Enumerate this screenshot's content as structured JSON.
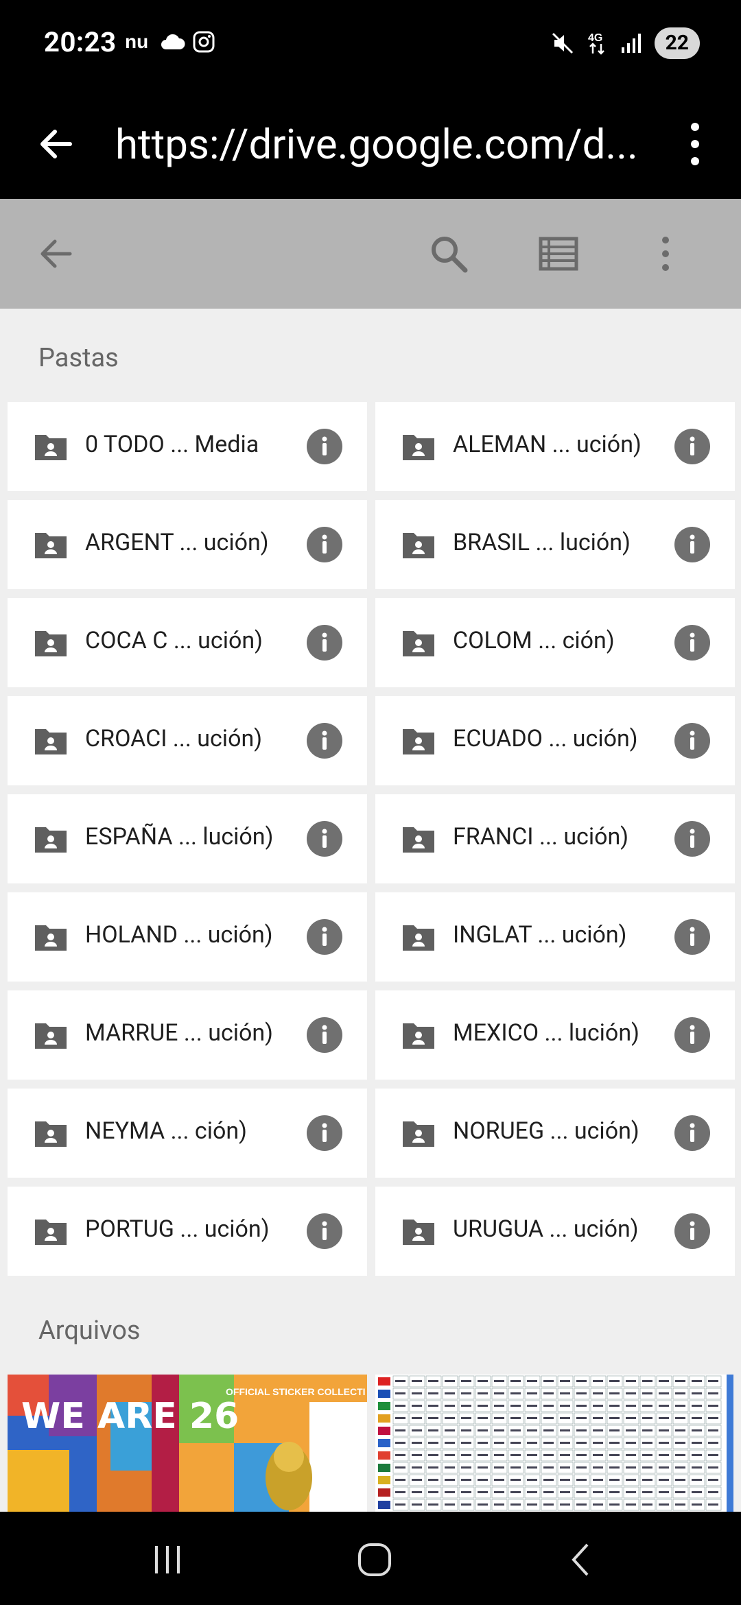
{
  "status_bar": {
    "time": "20:23",
    "left_icons": [
      "nu-app-icon",
      "cloud-icon",
      "instagram-icon"
    ],
    "right_icons": [
      "mute-icon",
      "4g-icon",
      "signal-icon"
    ],
    "battery": "22"
  },
  "browser": {
    "url": "https://drive.google.com/d..."
  },
  "section_folders": "Pastas",
  "section_files": "Arquivos",
  "folders": [
    {
      "name": "0 TODO ... Media"
    },
    {
      "name": "ALEMAN ... ución)"
    },
    {
      "name": "ARGENT ... ución)"
    },
    {
      "name": "BRASIL ... lución)"
    },
    {
      "name": "COCA C ... ución)"
    },
    {
      "name": "COLOM ... ción)"
    },
    {
      "name": "CROACI ... ución)"
    },
    {
      "name": "ECUADO ... ución)"
    },
    {
      "name": "ESPAÑA ... lución)"
    },
    {
      "name": "FRANCI ... ución)"
    },
    {
      "name": "HOLAND ... ución)"
    },
    {
      "name": "INGLAT ... ución)"
    },
    {
      "name": "MARRUE ... ución)"
    },
    {
      "name": "MEXICO ... lución)"
    },
    {
      "name": "NEYMA ... ción)"
    },
    {
      "name": "NORUEG ... ución)"
    },
    {
      "name": "PORTUG ... ución)"
    },
    {
      "name": "URUGUA ... ución)"
    }
  ],
  "files": [
    {
      "thumb_text_1": "WE ARE 26",
      "thumb_text_2": "OFFICIAL STICKER COLLECTI"
    },
    {
      "thumb_kind": "sticker-checklist-grid"
    }
  ],
  "colors": {
    "status_bg": "#000000",
    "appbar_bg": "#b4b4b4",
    "page_bg": "#efefef",
    "card_bg": "#ffffff",
    "icon_gray": "#5f5f5f"
  }
}
